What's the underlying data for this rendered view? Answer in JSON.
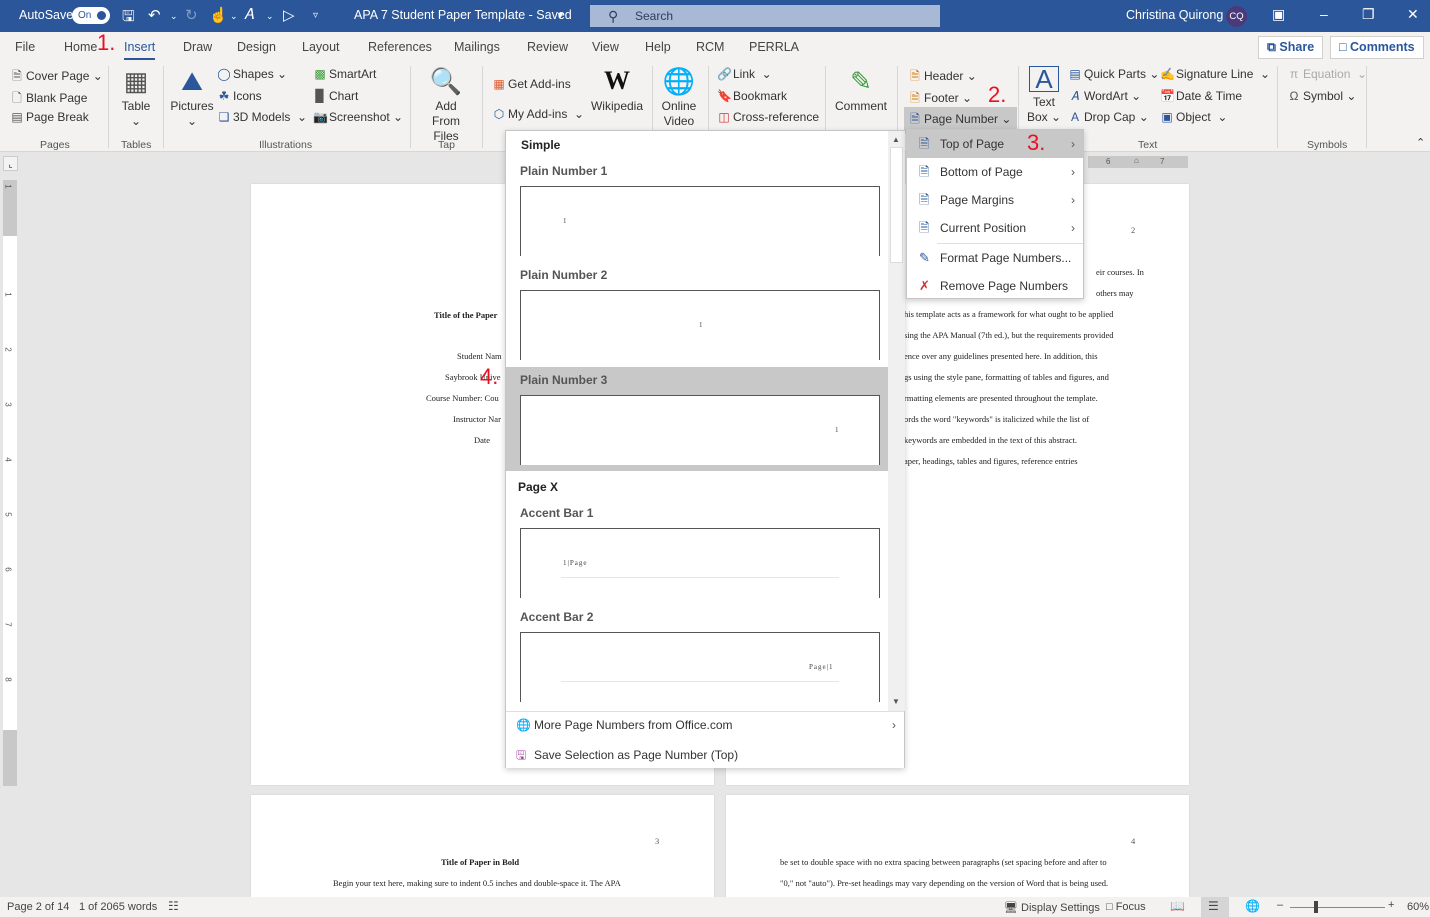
{
  "titlebar": {
    "autosave_label": "AutoSave",
    "autosave_state": "On",
    "doc_title": "APA 7 Student Paper Template  -  Saved",
    "search_placeholder": "Search",
    "user_name": "Christina Quirong",
    "user_initials": "CQ"
  },
  "tabs": [
    "File",
    "Home",
    "Insert",
    "Draw",
    "Design",
    "Layout",
    "References",
    "Mailings",
    "Review",
    "View",
    "Help",
    "RCM",
    "PERRLA"
  ],
  "active_tab": "Insert",
  "share_label": "Share",
  "comments_label": "Comments",
  "ribbon": {
    "pages": {
      "items": [
        "Cover Page",
        "Blank Page",
        "Page Break"
      ],
      "group": "Pages"
    },
    "tables": {
      "table": "Table",
      "group": "Tables"
    },
    "illustrations": {
      "pictures": "Pictures",
      "shapes": "Shapes",
      "icons": "Icons",
      "models": "3D Models",
      "smartart": "SmartArt",
      "chart": "Chart",
      "screenshot": "Screenshot",
      "group": "Illustrations"
    },
    "tap": {
      "add_line1": "Add",
      "add_line2": "From Files",
      "group": "Tap"
    },
    "addins": {
      "get": "Get Add-ins",
      "my": "My Add-ins",
      "wikipedia": "Wikipedia"
    },
    "media": {
      "line1": "Online",
      "line2": "Video"
    },
    "links": {
      "link": "Link",
      "bookmark": "Bookmark",
      "crossref": "Cross-reference"
    },
    "comment": "Comment",
    "headerfooter": {
      "header": "Header",
      "footer": "Footer",
      "page_number": "Page Number"
    },
    "text": {
      "textbox1": "Text",
      "textbox2": "Box",
      "quickparts": "Quick Parts",
      "wordart": "WordArt",
      "dropcap": "Drop Cap",
      "signature": "Signature Line",
      "datetime": "Date & Time",
      "object": "Object",
      "group": "Text"
    },
    "symbols": {
      "equation": "Equation",
      "symbol": "Symbol",
      "group": "Symbols"
    }
  },
  "steps": [
    "1.",
    "2.",
    "3.",
    "4."
  ],
  "gallery": {
    "section_simple": "Simple",
    "items_simple": [
      {
        "label": "Plain Number 1",
        "preview": "1"
      },
      {
        "label": "Plain Number 2",
        "preview": "1"
      },
      {
        "label": "Plain Number 3",
        "preview": "1"
      }
    ],
    "selected": "Plain Number 3",
    "section_pagex": "Page X",
    "items_pagex": [
      {
        "label": "Accent Bar 1",
        "preview": "1|Page"
      },
      {
        "label": "Accent Bar 2",
        "preview": "Page|1"
      }
    ],
    "footer": [
      "More Page Numbers from Office.com",
      "Save Selection as Page Number (Top)"
    ]
  },
  "submenu": {
    "items": [
      "Top of Page",
      "Bottom of Page",
      "Page Margins",
      "Current Position",
      "Format Page Numbers...",
      "Remove Page Numbers"
    ],
    "highlighted": "Top of Page"
  },
  "ruler": {
    "h_labels": [
      "6",
      "7"
    ],
    "v_labels": [
      "1",
      "1",
      "2",
      "3",
      "4",
      "5",
      "6",
      "7",
      "8"
    ]
  },
  "pages": {
    "page1": {
      "title": "Title of the Paper",
      "lines": [
        "Student Nam",
        "Saybrook Unive",
        "Course Number: Cou",
        "Instructor Nar",
        "Date"
      ]
    },
    "page2": {
      "number": "2",
      "lines": [
        "eir courses. In",
        "others may",
        "his template acts as a framework for what ought to be applied",
        "sing the APA Manual (7th ed.), but the requirements provided",
        "ence over any guidelines presented here. In addition, this",
        "gs using the style pane, formatting of tables and figures, and",
        "rmatting elements are presented throughout the template.",
        "ords the word \"keywords\" is italicized while the list of",
        "keywords are embedded in the text of this abstract.",
        "aper, headings, tables and figures, reference entries"
      ]
    },
    "page3": {
      "number": "3",
      "title": "Title of Paper in Bold",
      "line": "Begin your text here, making sure to indent 0.5 inches and double-space it. The APA"
    },
    "page4": {
      "number": "4",
      "line1": "be set to double space with no extra spacing between paragraphs (set spacing before and after to",
      "line2": "\"0,\" not \"auto\"). Pre-set headings may vary depending on the version of Word that is being used."
    }
  },
  "status": {
    "page": "Page 2 of 14",
    "words": "1 of 2065 words",
    "display_settings": "Display Settings",
    "focus": "Focus",
    "zoom_level": "60%",
    "zoom_fraction": 0.6
  }
}
